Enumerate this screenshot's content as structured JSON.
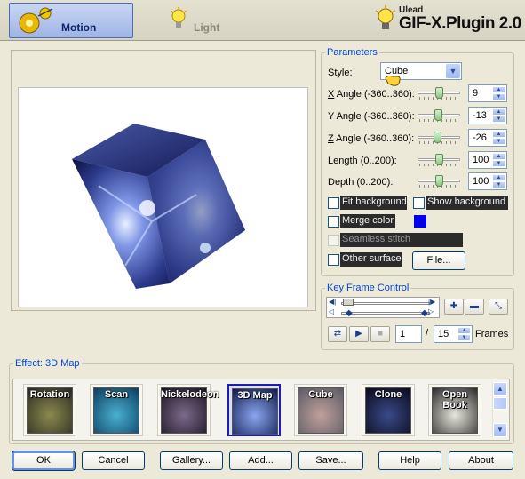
{
  "tabs": [
    {
      "label": "Motion",
      "icon": "gears-icon",
      "active": true
    },
    {
      "label": "Light",
      "icon": "lightbulb-icon",
      "active": false
    }
  ],
  "brand": {
    "small": "Ulead",
    "title": "GIF-X.Plugin 2.0",
    "icon": "lightbulb-icon"
  },
  "parameters": {
    "legend": "Parameters",
    "style_label": "Style:",
    "style_value": "Cube",
    "rows": [
      {
        "label_u": "X",
        "label_rest": " Angle (-360..360):",
        "value": "9",
        "level": 0.51
      },
      {
        "label_u": "",
        "label_rest": "Y Angle (-360..360):",
        "value": "-13",
        "level": 0.48
      },
      {
        "label_u": "Z",
        "label_rest": " Angle (-360..360):",
        "value": "-26",
        "level": 0.46
      },
      {
        "label_u": "",
        "label_rest": "Length (0..200):",
        "value": "100",
        "level": 0.5
      },
      {
        "label_u": "",
        "label_rest": "Depth (0..200):",
        "value": "100",
        "level": 0.5
      }
    ],
    "fit_background": "Fit background",
    "show_background": "Show background",
    "merge_color": "Merge color",
    "merge_color_swatch": "#0000f0",
    "seamless_stitch": "Seamless stitch",
    "other_surface": "Other surface",
    "file_button": "File..."
  },
  "keyframe": {
    "legend": "Key Frame Control",
    "current_frame": "1",
    "separator": "/",
    "total_frames": "15",
    "frames_label": "Frames"
  },
  "effects": {
    "legend": "Effect: 3D Map",
    "items": [
      {
        "label": "Rotation",
        "colors": [
          "#2a2a22",
          "#8a8a4e"
        ]
      },
      {
        "label": "Scan",
        "colors": [
          "#0c3c60",
          "#4ab0d0"
        ]
      },
      {
        "label": "Nickelodeon",
        "colors": [
          "#1a1220",
          "#7c6a8a"
        ]
      },
      {
        "label": "3D Map",
        "colors": [
          "#101a4a",
          "#8aa6f0"
        ]
      },
      {
        "label": "Cube",
        "colors": [
          "#5a5a66",
          "#c0a09a"
        ]
      },
      {
        "label": "Clone",
        "colors": [
          "#0a0a18",
          "#3a4a8a"
        ]
      },
      {
        "label": "Open Book",
        "colors": [
          "#2a2a2a",
          "#e8e6dc"
        ]
      }
    ],
    "selected": "3D Map"
  },
  "buttons": {
    "ok": "OK",
    "cancel": "Cancel",
    "gallery": "Gallery...",
    "add": "Add...",
    "save": "Save...",
    "help": "Help",
    "about": "About"
  }
}
